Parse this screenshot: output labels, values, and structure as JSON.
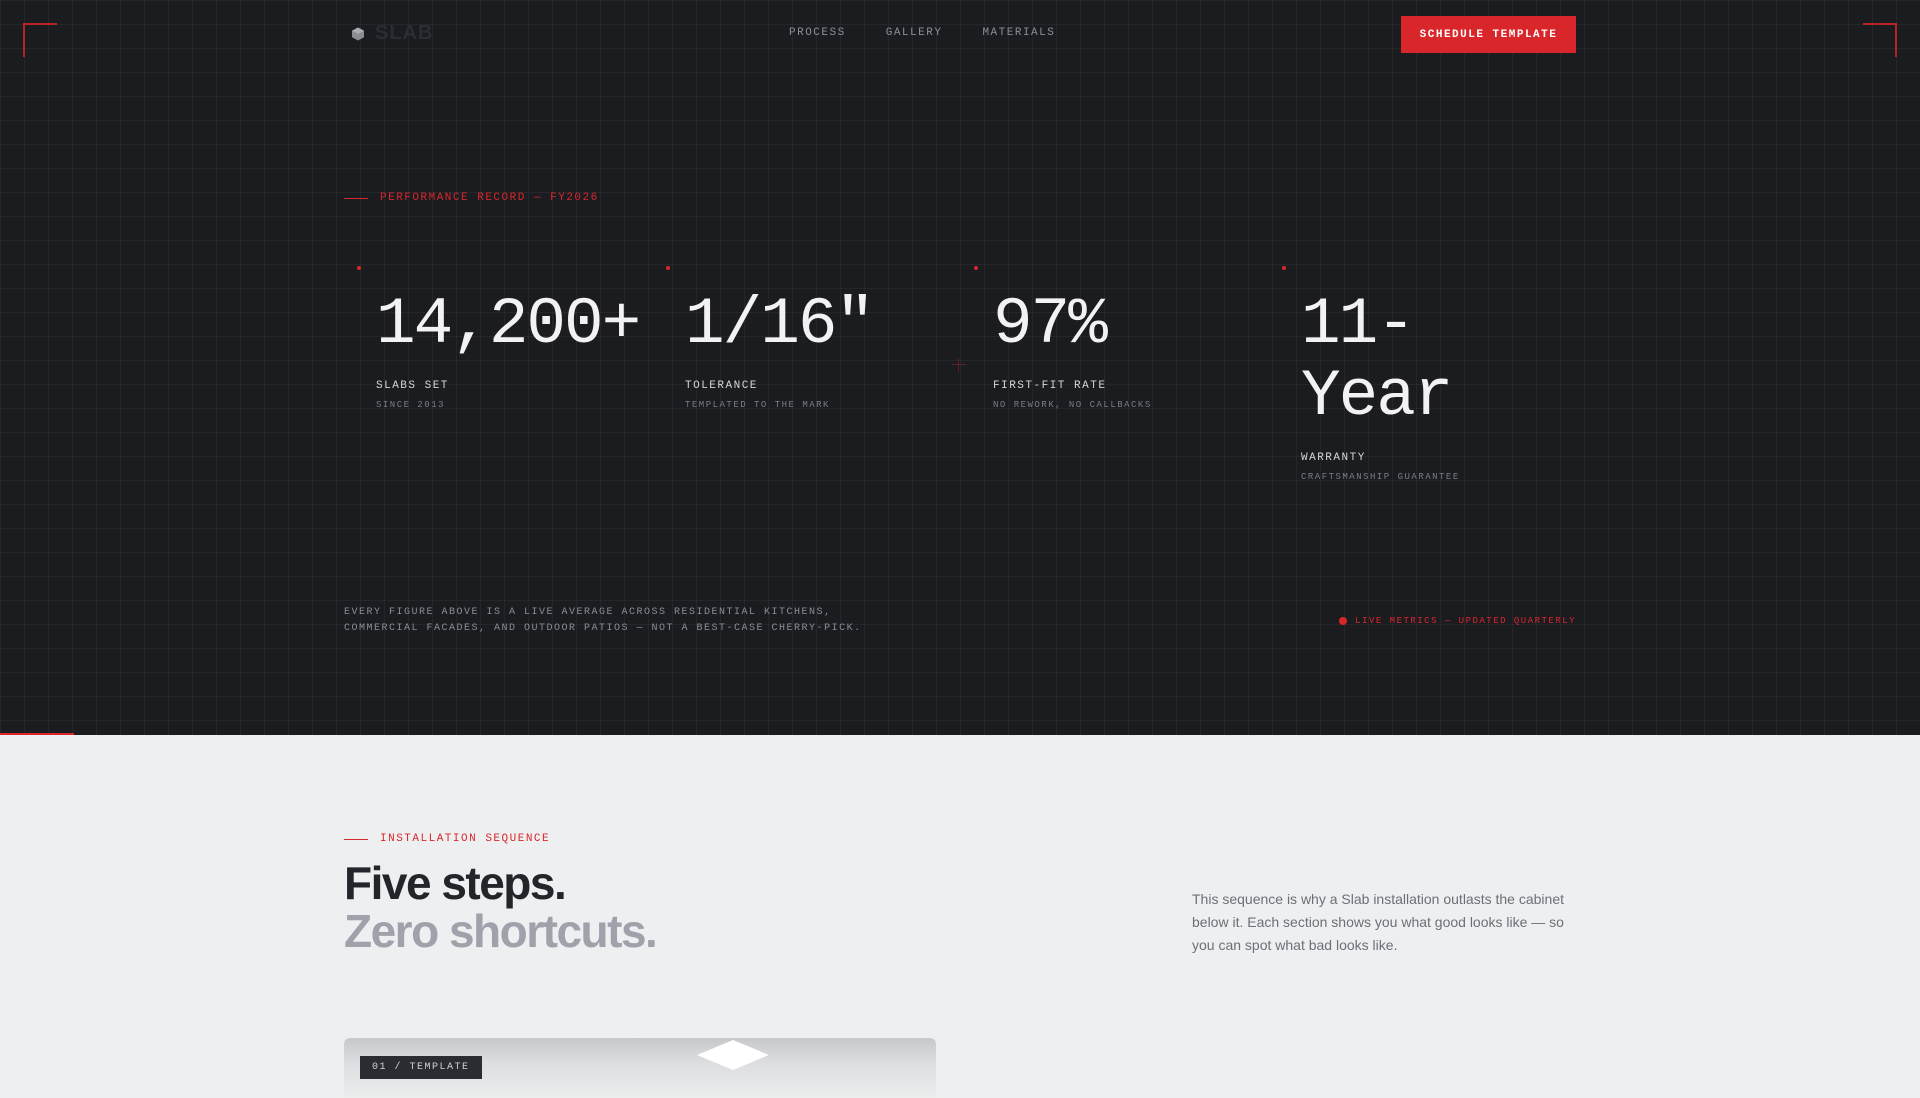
{
  "brand": {
    "name": "SLAB",
    "icon": "hexagon-logo-icon"
  },
  "nav": {
    "items": [
      {
        "label": "PROCESS"
      },
      {
        "label": "GALLERY"
      },
      {
        "label": "MATERIALS"
      }
    ],
    "cta_label": "SCHEDULE TEMPLATE"
  },
  "hero": {
    "eyebrow": "PERFORMANCE RECORD — FY2026",
    "stats": [
      {
        "value": "14,200+",
        "label": "SLABS SET",
        "sub": "SINCE 2013"
      },
      {
        "value": "1/16\"",
        "label": "TOLERANCE",
        "sub": "TEMPLATED TO THE MARK"
      },
      {
        "value": "97%",
        "label": "FIRST-FIT RATE",
        "sub": "NO REWORK, NO CALLBACKS"
      },
      {
        "value": "11-Year",
        "label": "WARRANTY",
        "sub": "CRAFTSMANSHIP GUARANTEE"
      }
    ],
    "footnote": "EVERY FIGURE ABOVE IS A LIVE AVERAGE ACROSS RESIDENTIAL KITCHENS, COMMERCIAL FACADES, AND OUTDOOR PATIOS — NOT A BEST-CASE CHERRY-PICK.",
    "live_label": "LIVE METRICS — UPDATED QUARTERLY"
  },
  "section": {
    "eyebrow": "INSTALLATION SEQUENCE",
    "headline_dark": "Five steps.",
    "headline_muted": "Zero shortcuts.",
    "intro": "This sequence is why a Slab installation outlasts the cabinet below it. Each section shows you what good looks like — so you can spot what bad looks like.",
    "card_tag": "01 / TEMPLATE"
  },
  "colors": {
    "accent": "#d9262b",
    "dark_bg": "#1b1c20",
    "light_bg": "#eeeff1"
  }
}
